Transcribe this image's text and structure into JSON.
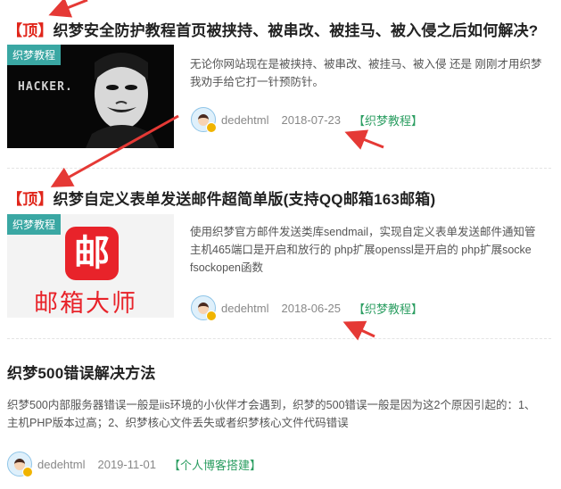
{
  "posts": [
    {
      "top_tag": "【顶】",
      "title": "织梦安全防护教程首页被挟持、被串改、被挂马、被入侵之后如何解决?",
      "thumb_category": "织梦教程",
      "thumb_text": "HACKER.",
      "excerpt_lines": [
        "无论你网站现在是被挟持、被串改、被挂马、被入侵 还是 刚刚才用织梦",
        "我劝手给它打一针预防针。"
      ],
      "author": "dedehtml",
      "date": "2018-07-23",
      "category": "【织梦教程】"
    },
    {
      "top_tag": "【顶】",
      "title": "织梦自定义表单发送邮件超简单版(支持QQ邮箱163邮箱)",
      "thumb_category": "织梦教程",
      "thumb_logo_char": "邮",
      "thumb_caption": "邮箱大师",
      "excerpt_lines": [
        "使用织梦官方邮件发送类库sendmail，实现自定义表单发送邮件通知管",
        "主机465端口是开启和放行的 php扩展openssl是开启的 php扩展socke",
        "fsockopen函数"
      ],
      "author": "dedehtml",
      "date": "2018-06-25",
      "category": "【织梦教程】"
    },
    {
      "title": "织梦500错误解决方法",
      "excerpt_lines": [
        "织梦500内部服务器错误一般是iis环境的小伙伴才会遇到，织梦的500错误一般是因为这2个原因引起的：1、",
        "主机PHP版本过高；2、织梦核心文件丢失或者织梦核心文件代码错误"
      ],
      "author": "dedehtml",
      "date": "2019-11-01",
      "category": "【个人博客搭建】"
    }
  ],
  "colors": {
    "top_red": "#e0261b",
    "category_green": "#2c9e62",
    "tag_teal": "#3aa7a3",
    "arrow_red": "#e53935"
  },
  "annotation_icons": [
    "red-arrow-icon"
  ]
}
